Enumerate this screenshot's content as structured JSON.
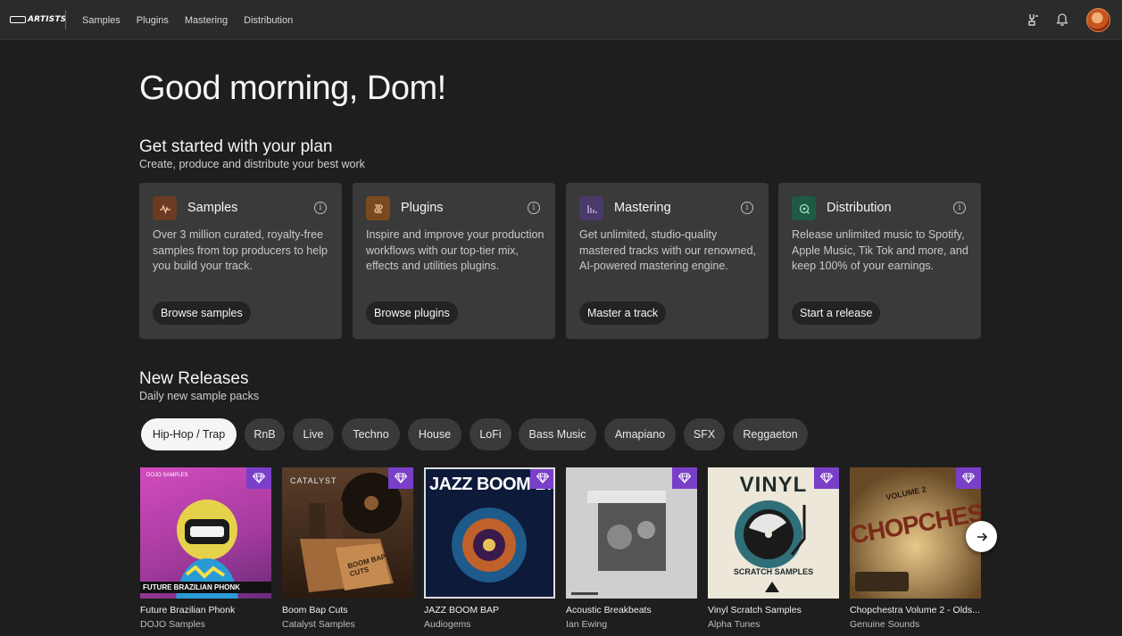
{
  "header": {
    "logo_text": "ARTISTS",
    "nav": [
      "Samples",
      "Plugins",
      "Mastering",
      "Distribution"
    ],
    "icons": [
      "tuning-fork-icon",
      "bell-icon"
    ]
  },
  "greeting": "Good morning, Dom!",
  "plan": {
    "title": "Get started with your plan",
    "subtitle": "Create, produce and distribute your best work",
    "cards": [
      {
        "title": "Samples",
        "icon": "waveform-icon",
        "color": "#6b3a22",
        "desc": "Over 3 million curated, royalty-free samples from top producers to help you build your track.",
        "button": "Browse samples"
      },
      {
        "title": "Plugins",
        "icon": "plugin-icon",
        "color": "#7a4a1e",
        "desc": "Inspire and improve your production workflows with our top-tier mix, effects and utilities plugins.",
        "button": "Browse plugins"
      },
      {
        "title": "Mastering",
        "icon": "bars-icon",
        "color": "#4a3a6a",
        "desc": "Get unlimited, studio-quality mastered tracks with our renowned, AI-powered mastering engine.",
        "button": "Master a track"
      },
      {
        "title": "Distribution",
        "icon": "distribution-icon",
        "color": "#1f5a45",
        "desc": "Release unlimited music to Spotify, Apple Music, Tik Tok and more, and keep 100% of your earnings.",
        "button": "Start a release"
      }
    ]
  },
  "releases": {
    "title": "New Releases",
    "subtitle": "Daily new sample packs",
    "genres": [
      "Hip-Hop / Trap",
      "RnB",
      "Live",
      "Techno",
      "House",
      "LoFi",
      "Bass Music",
      "Amapiano",
      "SFX",
      "Reggaeton"
    ],
    "active_genre": "Hip-Hop / Trap",
    "packs": [
      {
        "name": "Future Brazilian Phonk",
        "label": "DOJO Samples",
        "art_text": "FUTURE BRAZILIAN PHONK",
        "badge": "DOJO SAMPLES"
      },
      {
        "name": "Boom Bap Cuts",
        "label": "Catalyst Samples",
        "art_text": "BOOM BAP CUTS",
        "badge": "CATALYST"
      },
      {
        "name": "JAZZ BOOM BAP",
        "label": "Audiogems",
        "art_text": "JAZZ BOOM BAP",
        "badge": ""
      },
      {
        "name": "Acoustic Breakbeats",
        "label": "Ian Ewing",
        "art_text": "",
        "badge": ""
      },
      {
        "name": "Vinyl Scratch Samples",
        "label": "Alpha Tunes",
        "art_text": "VINYL",
        "badge": "SCRATCH SAMPLES"
      },
      {
        "name": "Chopchestra Volume 2 - Olds...",
        "label": "Genuine Sounds",
        "art_text": "CHOPCHESTRA",
        "badge": "VOLUME 2"
      }
    ]
  },
  "colors": {
    "accent_gem": "#7a3fc8",
    "background": "#1e1e1e",
    "card": "#3a3a3a"
  }
}
